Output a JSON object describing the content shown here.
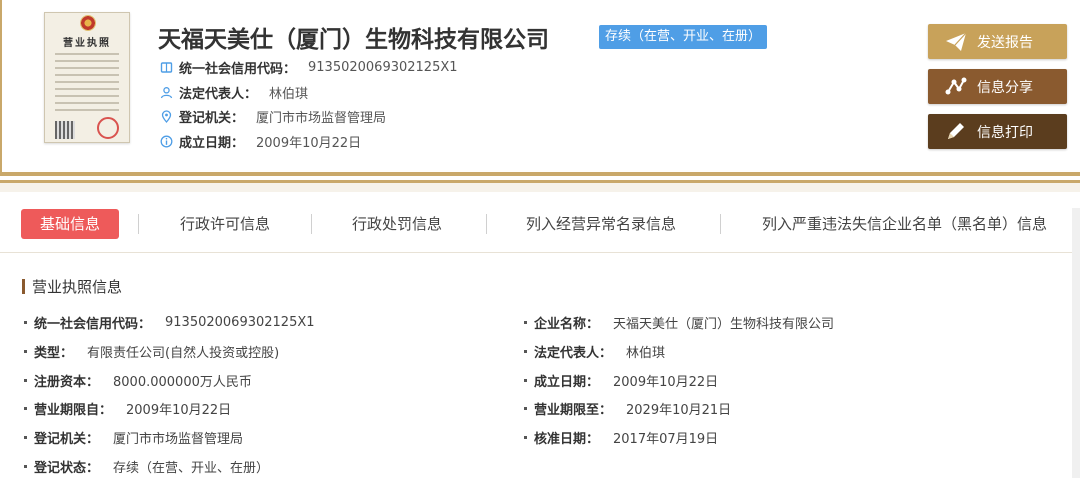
{
  "header": {
    "license_image": {
      "title": "营业执照"
    },
    "company_name": "天福天美仕（厦门）生物科技有限公司",
    "status_badge": "存续（在营、开业、在册）",
    "info": [
      {
        "icon": "id-card-icon",
        "label": "统一社会信用代码：",
        "value": "9135020069302125X1"
      },
      {
        "icon": "person-icon",
        "label": "法定代表人：",
        "value": "林伯琪"
      },
      {
        "icon": "location-pin-icon",
        "label": "登记机关：",
        "value": "厦门市市场监督管理局"
      },
      {
        "icon": "info-icon",
        "label": "成立日期：",
        "value": "2009年10月22日"
      }
    ],
    "actions": {
      "send_report": "发送报告",
      "share_info": "信息分享",
      "print_info": "信息打印"
    }
  },
  "tabs": [
    {
      "label": "基础信息",
      "active": true
    },
    {
      "label": "行政许可信息"
    },
    {
      "label": "行政处罚信息"
    },
    {
      "label": "列入经营异常名录信息"
    },
    {
      "label": "列入严重违法失信企业名单（黑名单）信息"
    }
  ],
  "section": {
    "title": "营业执照信息",
    "left": [
      {
        "label": "统一社会信用代码：",
        "value": "9135020069302125X1"
      },
      {
        "label": "类型：",
        "value": "有限责任公司(自然人投资或控股)"
      },
      {
        "label": "注册资本：",
        "value": "8000.000000万人民币"
      },
      {
        "label": "营业期限自：",
        "value": "2009年10月22日"
      },
      {
        "label": "登记机关：",
        "value": "厦门市市场监督管理局"
      },
      {
        "label": "登记状态：",
        "value": "存续（在营、开业、在册）"
      }
    ],
    "right": [
      {
        "label": "企业名称：",
        "value": "天福天美仕（厦门）生物科技有限公司"
      },
      {
        "label": "法定代表人：",
        "value": "林伯琪"
      },
      {
        "label": "成立日期：",
        "value": "2009年10月22日"
      },
      {
        "label": "营业期限至：",
        "value": "2029年10月21日"
      },
      {
        "label": "核准日期：",
        "value": "2017年07月19日"
      }
    ]
  },
  "colors": {
    "gold": "#c9a86a",
    "badge_blue": "#4f9ee6",
    "active_tab_red": "#ee5a5a",
    "btn_send": "#c8a25a",
    "btn_share": "#8a5a2f",
    "btn_print": "#5b3d1e"
  }
}
